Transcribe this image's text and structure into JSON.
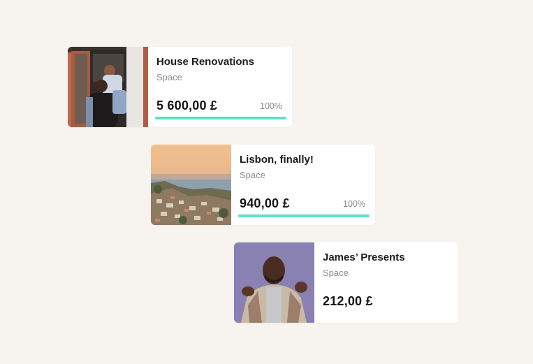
{
  "colors": {
    "background": "#f7f3ee",
    "progress": "#5fe0c8"
  },
  "cards": [
    {
      "title": "House Renovations",
      "subtitle": "Space",
      "amount": "5 600,00 £",
      "percent_label": "100%",
      "progress": 1.0,
      "image": "couple-piggyback-photo"
    },
    {
      "title": "Lisbon, finally!",
      "subtitle": "Space",
      "amount": "940,00 £",
      "percent_label": "100%",
      "progress": 1.0,
      "image": "lisbon-cityscape-photo"
    },
    {
      "title": "James’ Presents",
      "subtitle": "Space",
      "amount": "212,00 £",
      "image": "man-portrait-photo"
    }
  ]
}
